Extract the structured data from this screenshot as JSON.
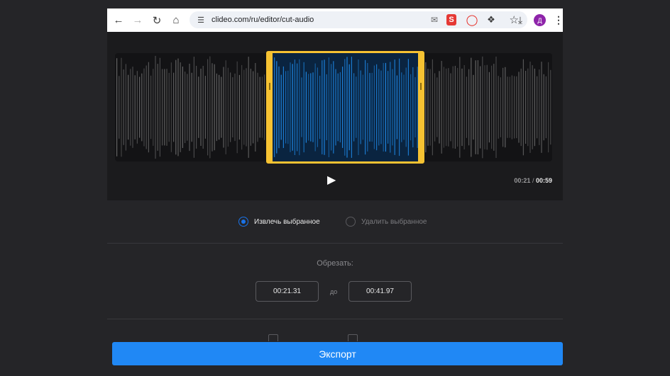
{
  "browser": {
    "url": "clideo.com/ru/editor/cut-audio",
    "icons": [
      "back-arrow-icon",
      "forward-arrow-icon",
      "reload-icon",
      "home-icon",
      "site-settings-icon",
      "bookmark-star-icon",
      "mail-icon",
      "s-extension-icon",
      "opera-icon",
      "extensions-puzzle-icon",
      "download-icon",
      "menu-kebab-icon"
    ],
    "avatar_letter": "Д"
  },
  "player": {
    "current_time": "00:21",
    "separator": "/",
    "duration": "00:59",
    "selection_start_fraction": 0.36,
    "selection_end_fraction": 0.71
  },
  "options": {
    "extract_label": "Извлечь выбранное",
    "delete_label": "Удалить выбранное",
    "selected": "extract"
  },
  "trim": {
    "label": "Обрезать:",
    "start": "00:21.31",
    "to_label": "до",
    "end": "00:41.97"
  },
  "export": {
    "label": "Экспорт"
  },
  "colors": {
    "accent": "#2088f5",
    "selection_border": "#f6c232",
    "wave_selected": "#1e88e5",
    "wave_unselected": "#8a8a8a"
  }
}
